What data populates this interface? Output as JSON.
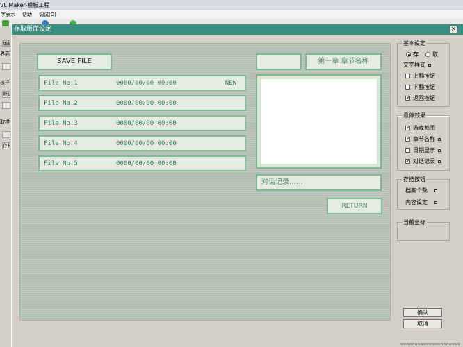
{
  "app": {
    "title": "VL Maker-模板工程",
    "menu": [
      "字表示",
      "帮助",
      "调试(D)"
    ],
    "left_items": [
      "编辑",
      "界面",
      "核样",
      "默认",
      "取样",
      "存档"
    ]
  },
  "dialog": {
    "title": "存取版面设定",
    "close_label": "×"
  },
  "canvas": {
    "save_file_label": "SAVE FILE",
    "files": [
      {
        "name": "File No.1",
        "date": "0000/00/00 00:00",
        "tag": "NEW"
      },
      {
        "name": "File No.2",
        "date": "0000/00/00 00:00",
        "tag": ""
      },
      {
        "name": "File No.3",
        "date": "0000/00/00 00:00",
        "tag": ""
      },
      {
        "name": "File No.4",
        "date": "0000/00/00 00:00",
        "tag": ""
      },
      {
        "name": "File No.5",
        "date": "0000/00/00 00:00",
        "tag": ""
      }
    ],
    "chapter_label": "第一章 章节名称",
    "dialogue_label": "对话记录……",
    "return_label": "RETURN"
  },
  "panel": {
    "basic": {
      "title": "基本设定",
      "radio_save": "存",
      "radio_load": "取",
      "text_style": "文字样式",
      "page_up": "上翻按钮",
      "page_down": "下翻按钮",
      "back": "返回按钮"
    },
    "hover": {
      "title": "悬停效果",
      "game_screenshot": "游戏截图",
      "chapter_name": "章节名称",
      "date_display": "日期显示",
      "dialogue_log": "对话记录"
    },
    "save_buttons": {
      "title": "存档按钮",
      "file_count": "档案个数",
      "content_setting": "内容设定"
    },
    "coords": {
      "title": "当前坐标"
    },
    "ok_label": "确认",
    "cancel_label": "取消"
  },
  "watermark": "wwwwwwwwwwwwwwwwwwwww"
}
